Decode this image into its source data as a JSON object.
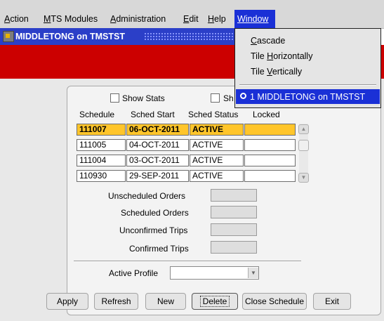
{
  "menubar": {
    "items": [
      {
        "first": "A",
        "rest": "ction"
      },
      {
        "first": "M",
        "rest": "TS Modules"
      },
      {
        "first": "A",
        "rest": "dministration"
      },
      {
        "first": "E",
        "rest": "dit"
      },
      {
        "first": "H",
        "rest": "elp"
      }
    ],
    "window": "Window"
  },
  "window": {
    "title": "MIDDLETONG on TMSTST"
  },
  "dropdown": {
    "items": [
      {
        "ul": "C",
        "rest": "ascade",
        "pre": ""
      },
      {
        "pre": "Tile ",
        "ul": "H",
        "rest": "orizontally"
      },
      {
        "pre": "Tile ",
        "ul": "V",
        "rest": "ertically"
      }
    ],
    "selected": "1 MIDDLETONG on TMSTST"
  },
  "checkboxes": {
    "show_stats": "Show Stats",
    "show_second": "Sh"
  },
  "table": {
    "headers": [
      "Schedule",
      "Sched Start",
      "Sched Status",
      "Locked"
    ],
    "rows": [
      {
        "schedule": "111007",
        "start": "06-OCT-2011",
        "status": "ACTIVE",
        "locked": ""
      },
      {
        "schedule": "111005",
        "start": "04-OCT-2011",
        "status": "ACTIVE",
        "locked": ""
      },
      {
        "schedule": "111004",
        "start": "03-OCT-2011",
        "status": "ACTIVE",
        "locked": ""
      },
      {
        "schedule": "110930",
        "start": "29-SEP-2011",
        "status": "ACTIVE",
        "locked": ""
      }
    ]
  },
  "summary": {
    "unscheduled_orders": "Unscheduled Orders",
    "scheduled_orders": "Scheduled Orders",
    "unconfirmed_trips": "Unconfirmed Trips",
    "confirmed_trips": "Confirmed Trips"
  },
  "profile": {
    "label": "Active Profile",
    "value": ""
  },
  "buttons": {
    "apply": "Apply",
    "refresh": "Refresh",
    "new": "New",
    "delete": "Delete",
    "close_schedule": "Close Schedule",
    "exit": "Exit"
  },
  "colors": {
    "menu_highlight": "#1a30d6",
    "title_bar": "#2b3fc8",
    "banner": "#cc0000",
    "selected_row": "#ffc52a"
  }
}
